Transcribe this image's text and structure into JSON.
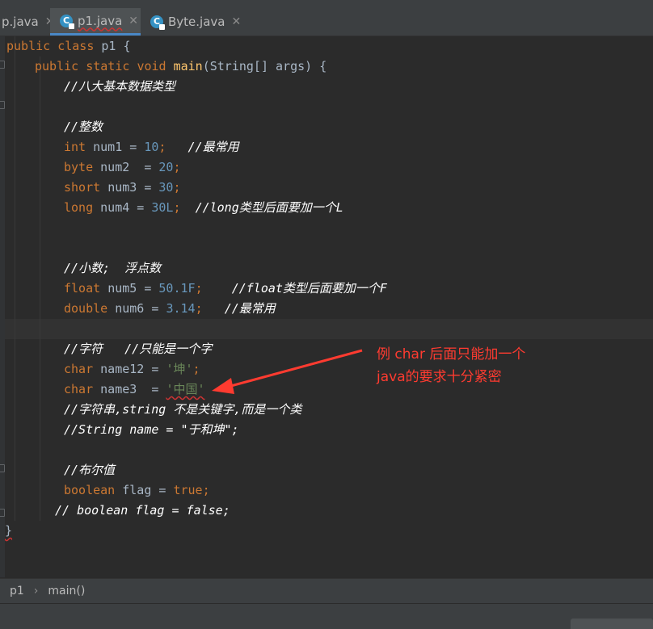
{
  "tabs": [
    {
      "label": "p.java",
      "close": "✕"
    },
    {
      "label": "p1.java",
      "close": "✕",
      "active": true
    },
    {
      "label": "Byte.java",
      "close": "✕"
    }
  ],
  "code": {
    "l1": {
      "a": "public",
      "b": " ",
      "c": "class",
      "d": " p1 {"
    },
    "l2": {
      "a": "public",
      "b": "static",
      "c": "void",
      "d": "main",
      "e": "(String[] args) {"
    },
    "l3": "//八大基本数据类型",
    "l4": "//整数",
    "l5": {
      "type": "int",
      "name": "num1",
      "eq": " = ",
      "val": "10",
      "semi": ";",
      "cmt": "//最常用"
    },
    "l6": {
      "type": "byte",
      "name": "num2",
      "eq": "  = ",
      "val": "20",
      "semi": ";"
    },
    "l7": {
      "type": "short",
      "name": "num3",
      "eq": " = ",
      "val": "30",
      "semi": ";"
    },
    "l8": {
      "type": "long",
      "name": "num4",
      "eq": " = ",
      "val": "30L",
      "semi": ";",
      "cmt": "//long类型后面要加一个L"
    },
    "l9": "//小数;  浮点数",
    "l10": {
      "type": "float",
      "name": "num5",
      "eq": " = ",
      "val": "50.1F",
      "semi": ";",
      "cmt": "//float类型后面要加一个F"
    },
    "l11": {
      "type": "double",
      "name": "num6",
      "eq": " = ",
      "val": "3.14",
      "semi": ";",
      "cmt": "//最常用"
    },
    "l12": "//字符   //只能是一个字",
    "l13": {
      "type": "char",
      "name": "name12",
      "eq": " = ",
      "val": "'坤'",
      "semi": ";"
    },
    "l14": {
      "type": "char",
      "name": "name3",
      "eq": "  = ",
      "val": "'中国'"
    },
    "l15": "//字符串,string 不是关键字,而是一个类",
    "l16": "//String name = \"于和坤\";",
    "l17": "//布尔值",
    "l18": {
      "type": "boolean",
      "name": "flag",
      "eq": " = ",
      "val": "true",
      "semi": ";"
    },
    "l19": "// boolean flag = false;",
    "l20": "}"
  },
  "annotation": {
    "line1": "例 char 后面只能加一个",
    "line2": "java的要求十分紧密"
  },
  "breadcrumb": {
    "cls": "p1",
    "sep": "›",
    "method": "main()"
  },
  "icons": {
    "java_file": "java-class-icon",
    "fold": "fold-marker-icon",
    "arrow": "red-arrow-icon"
  },
  "colors": {
    "annotation": "#ff3b30",
    "keyword": "#cc7832",
    "number": "#6897bb",
    "string": "#6a8759"
  }
}
